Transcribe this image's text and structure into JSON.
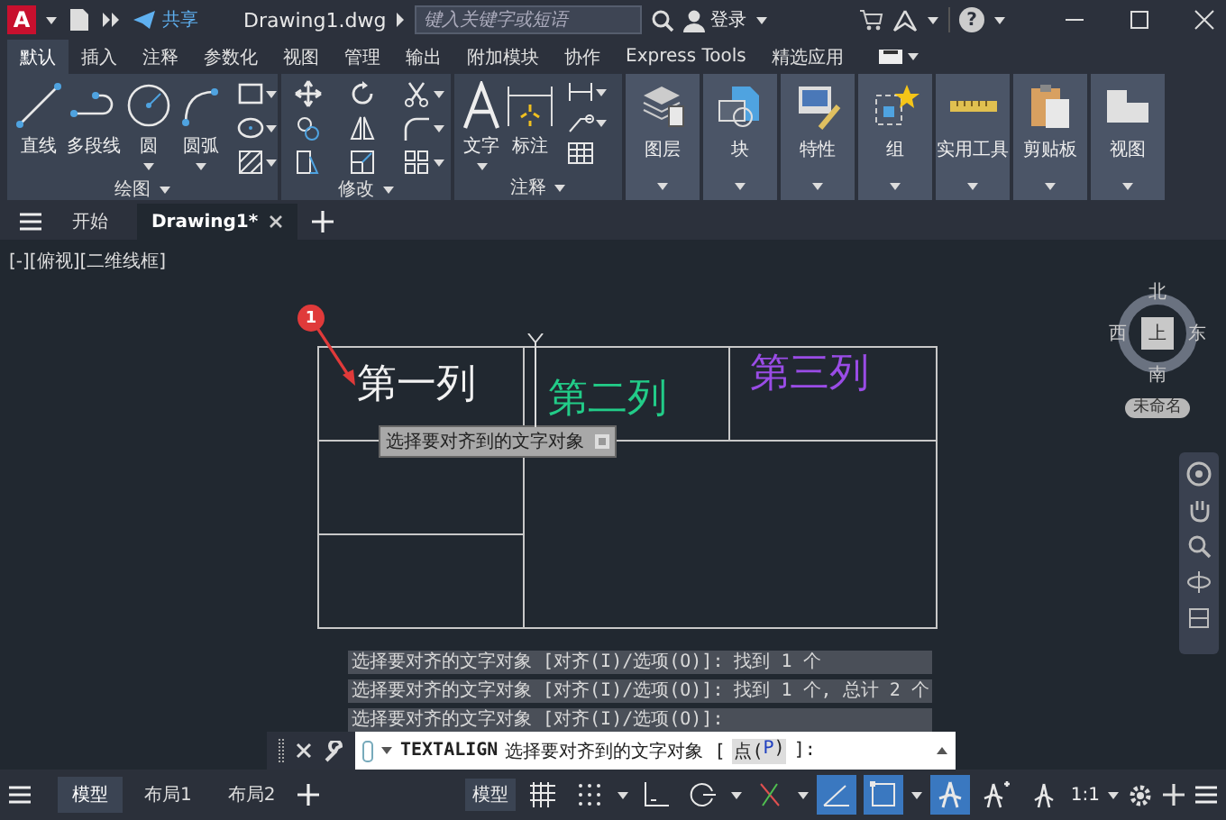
{
  "title_bar": {
    "app_logo": "A",
    "share": "共享",
    "file_name": "Drawing1.dwg",
    "search": {
      "placeholder": "键入关键字或短语"
    },
    "sign_in": "登录",
    "help": "?"
  },
  "ribbon_tabs": [
    {
      "label": "默认",
      "selected": true
    },
    {
      "label": "插入",
      "selected": false
    },
    {
      "label": "注释",
      "selected": false
    },
    {
      "label": "参数化",
      "selected": false
    },
    {
      "label": "视图",
      "selected": false
    },
    {
      "label": "管理",
      "selected": false
    },
    {
      "label": "输出",
      "selected": false
    },
    {
      "label": "附加模块",
      "selected": false
    },
    {
      "label": "协作",
      "selected": false
    },
    {
      "label": "Express Tools",
      "selected": false
    },
    {
      "label": "精选应用",
      "selected": false
    }
  ],
  "draw_panel": {
    "title": "绘图",
    "tools": [
      {
        "label": "直线",
        "dropdown": false
      },
      {
        "label": "多段线",
        "dropdown": false
      },
      {
        "label": "圆",
        "dropdown": true
      },
      {
        "label": "圆弧",
        "dropdown": true
      }
    ]
  },
  "modify_panel": {
    "title": "修改"
  },
  "annotation_panel": {
    "title": "注释",
    "tools": [
      {
        "label": "文字",
        "dropdown": true
      },
      {
        "label": "标注",
        "dropdown": false
      }
    ]
  },
  "big_buttons": [
    "图层",
    "块",
    "特性",
    "组",
    "实用工具",
    "剪贴板",
    "视图"
  ],
  "file_tabs": [
    {
      "label": "开始",
      "selected": false
    },
    {
      "label": "Drawing1*",
      "selected": true
    }
  ],
  "viewport_label": "[-][俯视][二维线框]",
  "drawing": {
    "cells": [
      {
        "text": "第一列",
        "color": "#f2f2f2"
      },
      {
        "text": "第二列",
        "color": "#22cc88"
      },
      {
        "text": "第三列",
        "color": "#9a4ce6"
      }
    ],
    "callout": "1",
    "tooltip": "选择要对齐到的文字对象"
  },
  "view_cube": {
    "north": "北",
    "east": "东",
    "south": "南",
    "west": "西",
    "face": "上",
    "ucs": "未命名"
  },
  "command_history": [
    "选择要对齐的文字对象 [对齐(I)/选项(O)]: 找到 1 个",
    "选择要对齐的文字对象 [对齐(I)/选项(O)]: 找到 1 个, 总计 2 个",
    "选择要对齐的文字对象 [对齐(I)/选项(O)]:"
  ],
  "command_line": {
    "command": "TEXTALIGN",
    "prompt": "选择要对齐到的文字对象 [",
    "option_name": "点(",
    "option_key": "P",
    "option_end": ")",
    "suffix": "]:"
  },
  "layout_tabs": [
    {
      "label": "模型",
      "selected": true
    },
    {
      "label": "布局1",
      "selected": false
    },
    {
      "label": "布局2",
      "selected": false
    }
  ],
  "status_bar": {
    "model": "模型",
    "scale": "1:1",
    "toggles": [
      {
        "on": false
      },
      {
        "on": false
      },
      {
        "on": false
      },
      {
        "on": false
      },
      {
        "on": false
      },
      {
        "on": true
      },
      {
        "on": true
      },
      {
        "on": true
      },
      {
        "on": false
      },
      {
        "on": false
      }
    ]
  }
}
